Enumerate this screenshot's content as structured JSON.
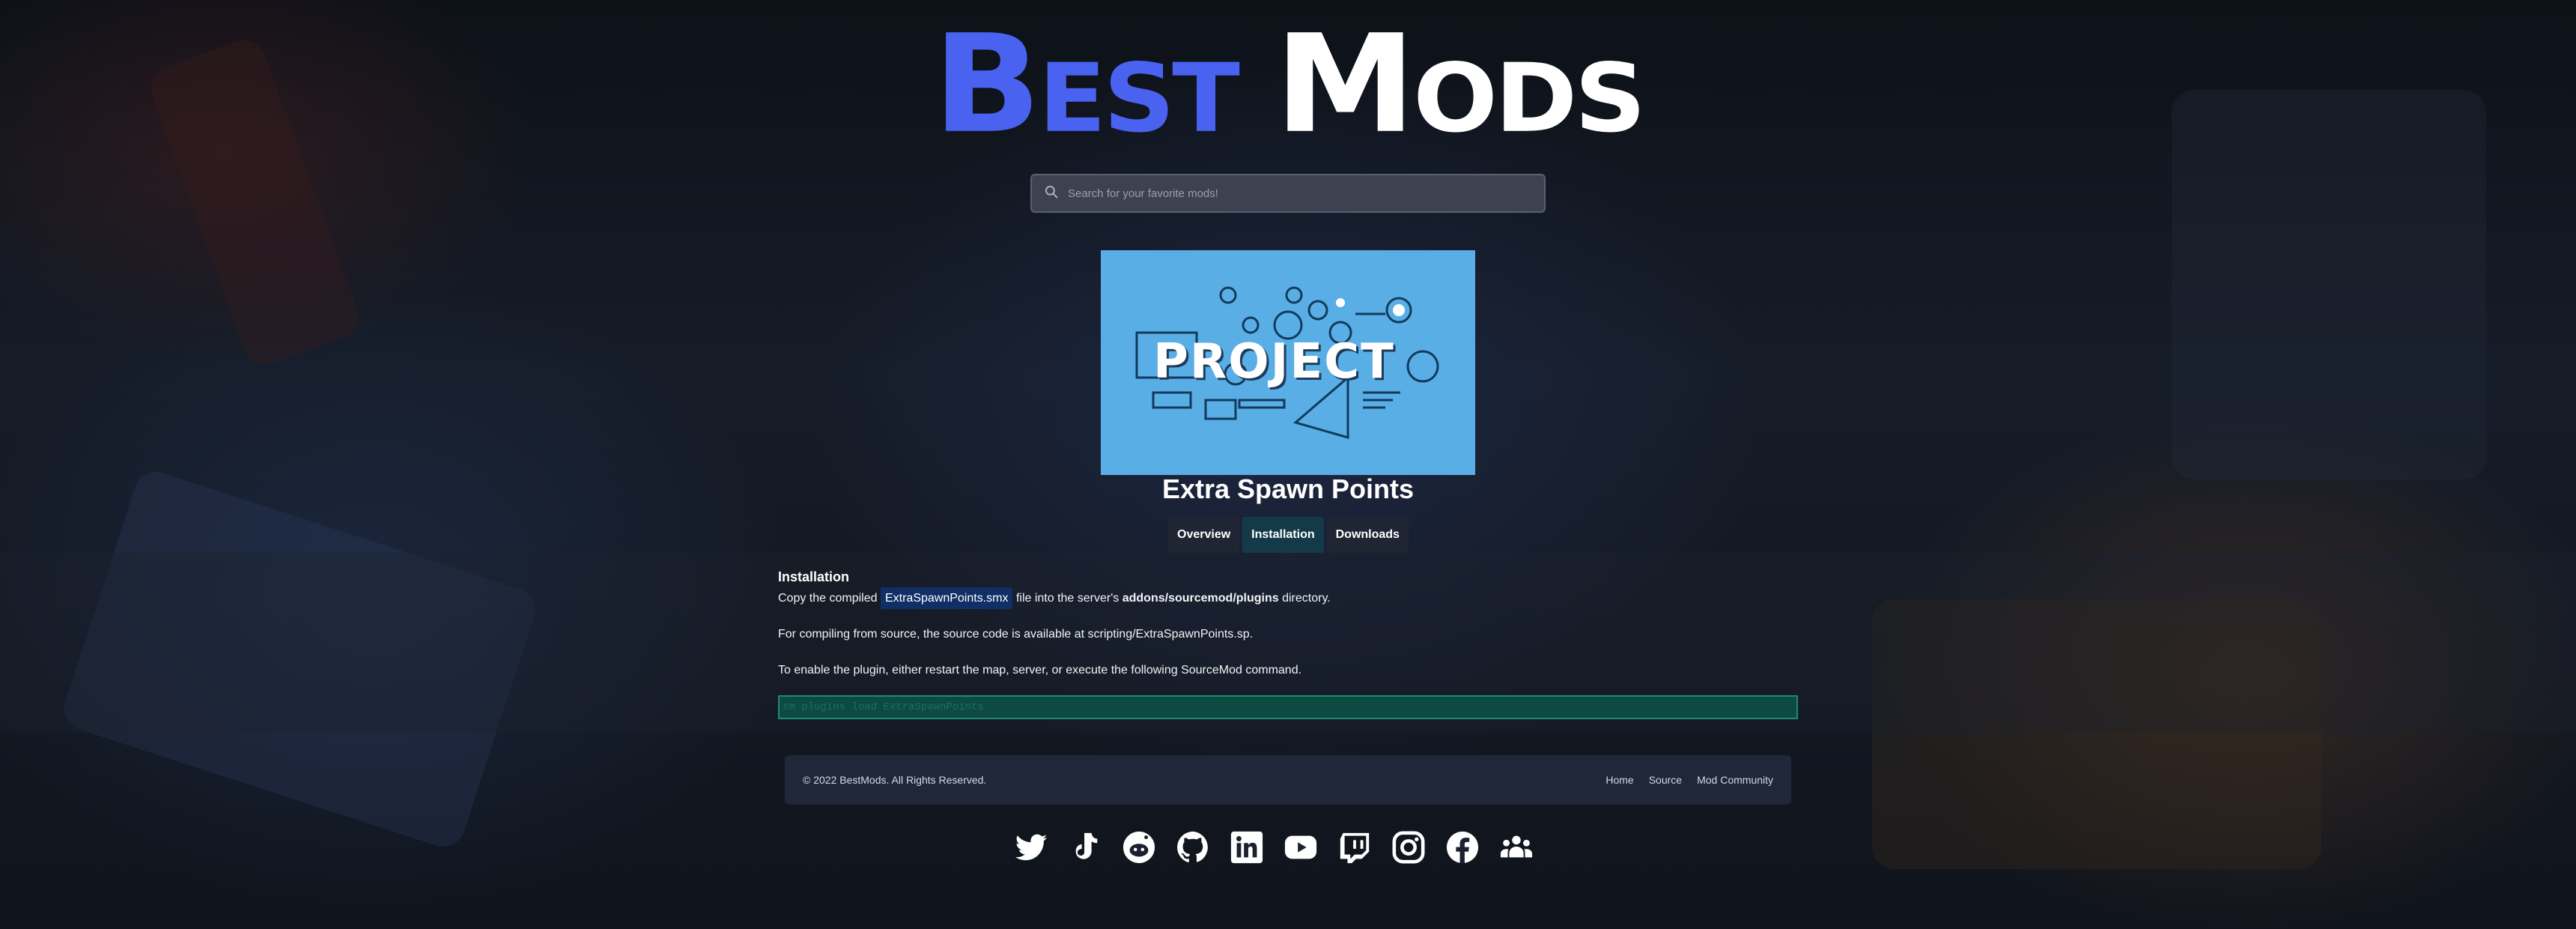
{
  "logo": {
    "word1": "Best",
    "word2": "Mods"
  },
  "search": {
    "placeholder": "Search for your favorite mods!"
  },
  "hero": {
    "word": "PROJECT"
  },
  "mod": {
    "title": "Extra Spawn Points"
  },
  "tabs": [
    {
      "label": "Overview"
    },
    {
      "label": "Installation"
    },
    {
      "label": "Downloads"
    }
  ],
  "installation": {
    "heading": "Installation",
    "line1_prefix": "Copy the compiled",
    "line1_file": "ExtraSpawnPoints.smx",
    "line1_middle": "file into the server's",
    "line1_path": "addons/sourcemod/plugins",
    "line1_suffix": "directory.",
    "line2": "For compiling from source, the source code is available at scripting/ExtraSpawnPoints.sp.",
    "line3": "To enable the plugin, either restart the map, server, or execute the following SourceMod command.",
    "command": "sm plugins load ExtraSpawnPoints"
  },
  "footer": {
    "copyright": "© 2022 BestMods. All Rights Reserved.",
    "links": [
      "Home",
      "Source",
      "Mod Community"
    ]
  },
  "social_icons": [
    "twitter-icon",
    "tiktok-icon",
    "reddit-icon",
    "github-icon",
    "linkedin-icon",
    "youtube-icon",
    "twitch-icon",
    "instagram-icon",
    "facebook-icon",
    "community-icon"
  ],
  "colors": {
    "accent_blue": "#4a62f0",
    "active_tab": "#143a4a",
    "code_bg": "#0c4a42"
  }
}
